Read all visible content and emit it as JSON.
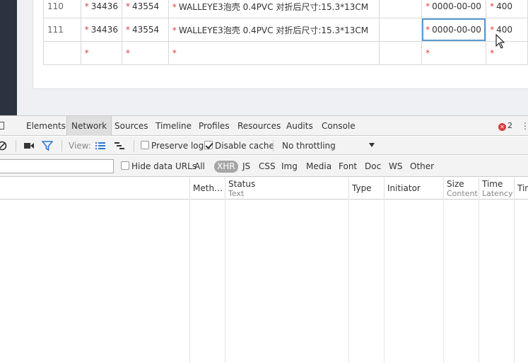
{
  "grid": {
    "rows": [
      {
        "no": "110",
        "c1": "34436",
        "c2": "43554",
        "desc": "WALLEYE3泡壳 0.4PVC 对折后尺寸:15.3*13CM",
        "c4": "",
        "date": "0000-00-00",
        "qty": "400"
      },
      {
        "no": "111",
        "c1": "34436",
        "c2": "43554",
        "desc": "WALLEYE3泡壳 0.4PVC 对折后尺寸:15.3*13CM",
        "c4": "",
        "date": "0000-00-00",
        "qty": "400"
      },
      {
        "no": "",
        "c1": "",
        "c2": "",
        "desc": "",
        "c4": "",
        "date": "",
        "qty": ""
      }
    ],
    "required_mark": "*"
  },
  "devtools": {
    "tabs": [
      "Elements",
      "Network",
      "Sources",
      "Timeline",
      "Profiles",
      "Resources",
      "Audits",
      "Console"
    ],
    "selected_tab": "Network",
    "error_count": "2",
    "toolbar": {
      "view_label": "View:",
      "preserve_log": "Preserve log",
      "disable_cache": "Disable cache",
      "throttling": "No throttling"
    },
    "filter": {
      "hide_data_urls": "Hide data URLs",
      "types": [
        "All",
        "XHR",
        "JS",
        "CSS",
        "Img",
        "Media",
        "Font",
        "Doc",
        "WS",
        "Other"
      ],
      "active_type": "XHR"
    },
    "columns": [
      {
        "name": "Meth…",
        "sub": ""
      },
      {
        "name": "Status",
        "sub": "Text"
      },
      {
        "name": "Type",
        "sub": ""
      },
      {
        "name": "Initiator",
        "sub": ""
      },
      {
        "name": "Size",
        "sub": "Content"
      },
      {
        "name": "Time",
        "sub": "Latency"
      },
      {
        "name": "Tin",
        "sub": ""
      }
    ]
  },
  "colors": {
    "required": "#e23c3c",
    "selection_border": "#5b9bd5",
    "sidebar_dark": "#2b3240",
    "error_badge": "#d93c3c",
    "active_chip": "#a6a6a6"
  },
  "icons": [
    "dock-icon",
    "clear-icon",
    "record-icon",
    "filter-icon",
    "list-view-icon",
    "waterfall-view-icon",
    "error-icon",
    "close-icon",
    "mouse-cursor-icon"
  ]
}
